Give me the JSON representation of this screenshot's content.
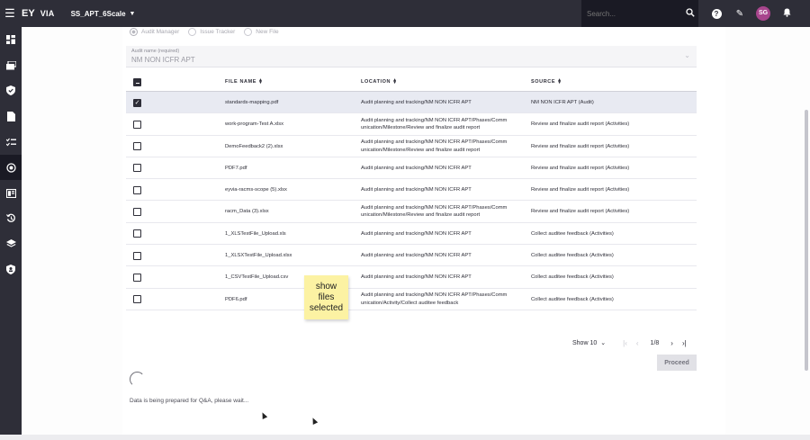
{
  "topbar": {
    "logo_ey": "EY",
    "logo_via": "VIA",
    "project_name": "SS_APT_6Scale",
    "search_placeholder": "Search...",
    "avatar_initials": "SG"
  },
  "sidebar": {
    "items": [
      {
        "icon": "dashboard-icon"
      },
      {
        "icon": "cards-icon"
      },
      {
        "icon": "shield-check-icon"
      },
      {
        "icon": "document-icon"
      },
      {
        "icon": "checklist-icon"
      },
      {
        "icon": "target-icon",
        "active": true
      },
      {
        "icon": "book-icon"
      },
      {
        "icon": "history-icon"
      },
      {
        "icon": "layers-icon"
      },
      {
        "icon": "badge-icon"
      }
    ]
  },
  "options": {
    "radios": [
      {
        "label": "Audit Manager",
        "selected": true
      },
      {
        "label": "Issue Tracker",
        "selected": false
      },
      {
        "label": "New File",
        "selected": false
      }
    ]
  },
  "audit_field": {
    "label": "Audit name (required)",
    "value": "NM NON ICFR APT"
  },
  "table": {
    "headers": {
      "file_name": "FILE NAME",
      "location": "LOCATION",
      "source": "SOURCE"
    },
    "rows": [
      {
        "checked": true,
        "file": "standards-mapping.pdf",
        "location": "Audit planning and tracking/NM NON ICFR APT",
        "source": "NM NON ICFR APT (Audit)"
      },
      {
        "checked": false,
        "file": "work-program-Test A.xlsx",
        "location": "Audit planning and tracking/NM NON ICFR APT/Phases/Comm\nunication/Milestone/Review and finalize audit report",
        "source": "Review and finalize audit report (Activities)"
      },
      {
        "checked": false,
        "file": "DemoFeedback2 (2).xlsx",
        "location": "Audit planning and tracking/NM NON ICFR APT/Phases/Comm\nunication/Milestone/Review and finalize audit report",
        "source": "Review and finalize audit report (Activities)"
      },
      {
        "checked": false,
        "file": "PDF7.pdf",
        "location": "Audit planning and tracking/NM NON ICFR APT",
        "source": "Review and finalize audit report (Activities)"
      },
      {
        "checked": false,
        "file": "eyvia-racms-scope (5).xlsx",
        "location": "Audit planning and tracking/NM NON ICFR APT",
        "source": "Review and finalize audit report (Activities)"
      },
      {
        "checked": false,
        "file": "racm_Data (3).xlsx",
        "location": "Audit planning and tracking/NM NON ICFR APT/Phases/Comm\nunication/Milestone/Review and finalize audit report",
        "source": "Review and finalize audit report (Activities)"
      },
      {
        "checked": false,
        "file": "1_XLSTestFile_Upload.xls",
        "location": "Audit planning and tracking/NM NON ICFR APT",
        "source": "Collect auditee feedback (Activities)"
      },
      {
        "checked": false,
        "file": "1_XLSXTestFile_Upload.xlsx",
        "location": "Audit planning and tracking/NM NON ICFR APT",
        "source": "Collect auditee feedback (Activities)"
      },
      {
        "checked": false,
        "file": "1_CSVTestFile_Upload.csv",
        "location": "Audit planning and tracking/NM NON ICFR APT",
        "source": "Collect auditee feedback (Activities)"
      },
      {
        "checked": false,
        "file": "PDF6.pdf",
        "location": "Audit planning and tracking/NM NON ICFR APT/Phases/Comm\nunication/Activity/Collect auditee feedback",
        "source": "Collect auditee feedback (Activities)"
      }
    ]
  },
  "pagination": {
    "show_label": "Show 10",
    "page_indicator": "1/8"
  },
  "proceed_label": "Proceed",
  "status_text": "Data is being prepared for Q&A, please wait...",
  "sticky_note": "show\nfiles\nselected",
  "colors": {
    "topbar": "#2e2e38",
    "brand_yellow": "#ffe600",
    "selected_row": "#e8eaf2",
    "avatar": "#a8458d",
    "sticky": "#fcf2a3"
  }
}
